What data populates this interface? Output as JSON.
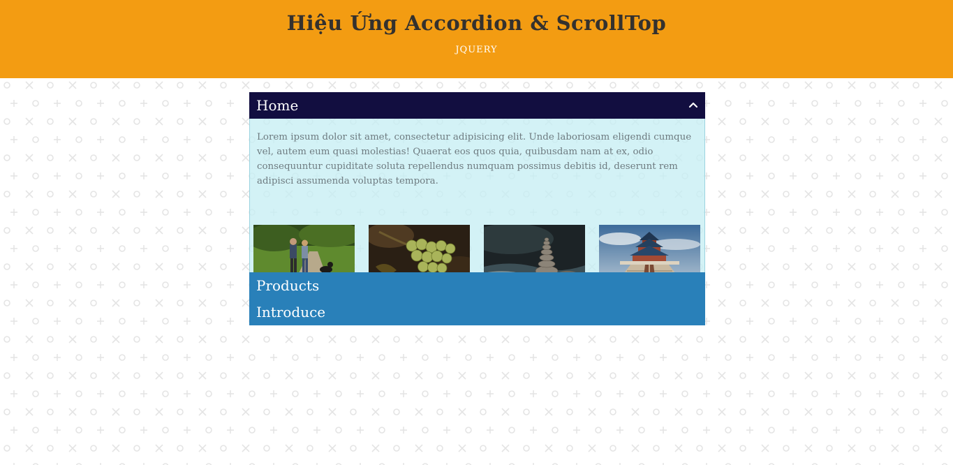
{
  "header": {
    "title": "Hiệu Ứng Accordion & ScrollTop",
    "subtitle": "JQUERY",
    "background": "#f39c12"
  },
  "accordion": {
    "sections": [
      {
        "label": "Home",
        "expanded": true,
        "icon": "chevron-up-icon",
        "body_text": "Lorem ipsum dolor sit amet, consectetur adipisicing elit. Unde laboriosam eligendi cumque vel, autem eum quasi molestias! Quaerat eos quos quia, quibusdam nam at ex, odio consequuntur cupiditate soluta repellendus numquam possimus debitis id, deserunt rem adipisci assumenda voluptas tempora.",
        "images": [
          "couple-walking-dog-photo",
          "grapes-photo",
          "stacked-stones-photo",
          "temple-of-heaven-photo"
        ]
      },
      {
        "label": "Products",
        "expanded": false
      },
      {
        "label": "Introduce",
        "expanded": false
      }
    ],
    "colors": {
      "active_header": "#120e40",
      "closed_header": "#2980b9",
      "body_background": "#d2f1f5"
    }
  }
}
